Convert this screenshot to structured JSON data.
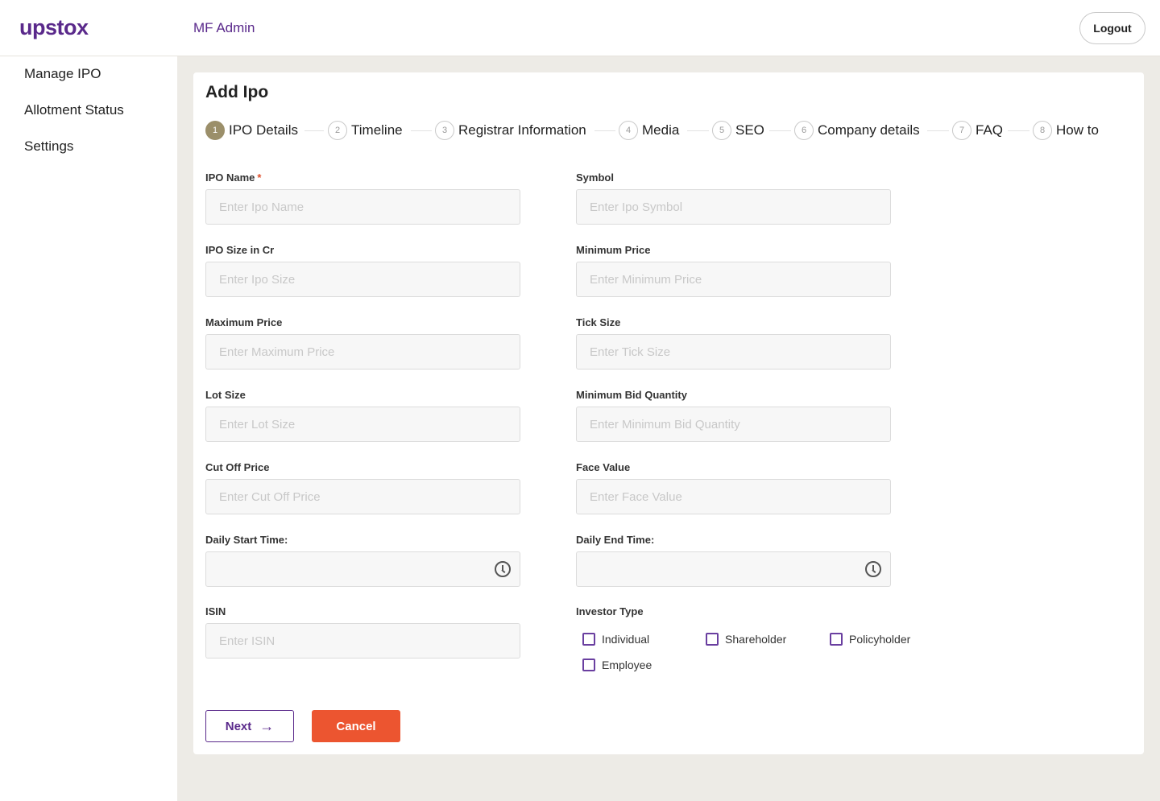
{
  "header": {
    "logo": "upstox",
    "app_title": "MF Admin",
    "logout_label": "Logout"
  },
  "sidebar": {
    "items": [
      {
        "label": "Manage IPO"
      },
      {
        "label": "Allotment Status"
      },
      {
        "label": "Settings"
      }
    ]
  },
  "page": {
    "title": "Add Ipo"
  },
  "steps": [
    {
      "num": "1",
      "label": "IPO Details",
      "active": true
    },
    {
      "num": "2",
      "label": "Timeline"
    },
    {
      "num": "3",
      "label": "Registrar Information"
    },
    {
      "num": "4",
      "label": "Media"
    },
    {
      "num": "5",
      "label": "SEO"
    },
    {
      "num": "6",
      "label": "Company details"
    },
    {
      "num": "7",
      "label": "FAQ"
    },
    {
      "num": "8",
      "label": "How to"
    }
  ],
  "form": {
    "ipo_name": {
      "label": "IPO Name",
      "required": "*",
      "placeholder": "Enter Ipo Name"
    },
    "symbol": {
      "label": "Symbol",
      "placeholder": "Enter Ipo Symbol"
    },
    "ipo_size": {
      "label": "IPO Size in Cr",
      "placeholder": "Enter Ipo Size"
    },
    "min_price": {
      "label": "Minimum Price",
      "placeholder": "Enter Minimum Price"
    },
    "max_price": {
      "label": "Maximum Price",
      "placeholder": "Enter Maximum Price"
    },
    "tick_size": {
      "label": "Tick Size",
      "placeholder": "Enter Tick Size"
    },
    "lot_size": {
      "label": "Lot Size",
      "placeholder": "Enter Lot Size"
    },
    "min_bid_qty": {
      "label": "Minimum Bid Quantity",
      "placeholder": "Enter Minimum Bid Quantity"
    },
    "cut_off_price": {
      "label": "Cut Off Price",
      "placeholder": "Enter Cut Off Price"
    },
    "face_value": {
      "label": "Face Value",
      "placeholder": "Enter Face Value"
    },
    "daily_start_time": {
      "label": "Daily Start Time:",
      "value": ""
    },
    "daily_end_time": {
      "label": "Daily End Time:",
      "value": ""
    },
    "isin": {
      "label": "ISIN",
      "placeholder": "Enter ISIN"
    },
    "investor_type": {
      "label": "Investor Type",
      "options": [
        "Individual",
        "Shareholder",
        "Policyholder",
        "Employee"
      ]
    }
  },
  "actions": {
    "next_label": "Next",
    "cancel_label": "Cancel"
  },
  "colors": {
    "brand": "#5a298b",
    "accent": "#ec5530",
    "active_step": "#9b8f6a",
    "background": "#edebe6"
  }
}
